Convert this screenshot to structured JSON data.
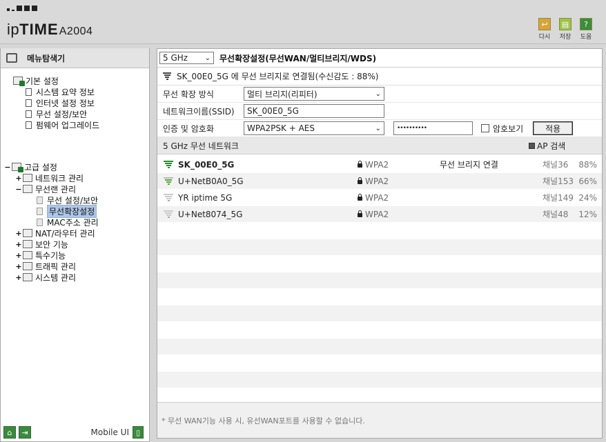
{
  "header": {
    "logo_text": "ipTIME",
    "model": "A2004",
    "actions": [
      {
        "label": "다시",
        "icon": "undo-icon",
        "color": "#d9a43a"
      },
      {
        "label": "저장",
        "icon": "save-icon",
        "color": "#9ec24a"
      },
      {
        "label": "도움",
        "icon": "help-icon",
        "color": "#3a8d3a"
      }
    ]
  },
  "sidebar": {
    "title": "메뉴탐색기",
    "basic": {
      "label": "기본 설정",
      "items": [
        "시스템 요약 정보",
        "인터넷 설정 정보",
        "무선 설정/보안",
        "펌웨어 업그레이드"
      ]
    },
    "advanced": {
      "toggle": "−",
      "label": "고급 설정",
      "items": [
        {
          "toggle": "+",
          "label": "네트워크 관리"
        },
        {
          "toggle": "−",
          "label": "무선랜 관리",
          "children": [
            "무선 설정/보안",
            "무선확장설정",
            "MAC주소 관리"
          ]
        },
        {
          "toggle": "+",
          "label": "NAT/라우터 관리"
        },
        {
          "toggle": "+",
          "label": "보안 기능"
        },
        {
          "toggle": "+",
          "label": "특수기능"
        },
        {
          "toggle": "+",
          "label": "트래픽 관리"
        },
        {
          "toggle": "+",
          "label": "시스템 관리"
        }
      ]
    },
    "footer": {
      "mobile_label": "Mobile UI"
    }
  },
  "main": {
    "band": "5 GHz",
    "title": "무선확장설정(무선WAN/멀티브리지/WDS)",
    "status": "SK_00E0_5G 에 무선 브리지로 연결됨(수신감도 : 88%)",
    "form": {
      "mode_label": "무선 확장 방식",
      "mode_value": "멀티 브리지(리피터)",
      "ssid_label": "네트워크이름(SSID)",
      "ssid_value": "SK_00E0_5G",
      "auth_label": "인증 및 암호화",
      "auth_value": "WPA2PSK + AES",
      "password_value": "••••••••••",
      "show_password_label": "암호보기",
      "apply_label": "적용"
    },
    "networks_header": "5 GHz 무선 네트워크",
    "ap_search_label": "AP 검색",
    "networks": [
      {
        "ssid": "SK_00E0_5G",
        "security": "WPA2",
        "status": "무선 브리지 연결",
        "channel": "채널36",
        "signal": "88%",
        "bold": true,
        "signal_color": "#2e8b2e"
      },
      {
        "ssid": "U+NetB0A0_5G",
        "security": "WPA2",
        "status": "",
        "channel": "채널153",
        "signal": "66%",
        "bold": false,
        "signal_color": "#5aa83a"
      },
      {
        "ssid": "YR iptime 5G",
        "security": "WPA2",
        "status": "",
        "channel": "채널149",
        "signal": "24%",
        "bold": false,
        "signal_color": "#aaaaaa"
      },
      {
        "ssid": "U+Net8074_5G",
        "security": "WPA2",
        "status": "",
        "channel": "채널48",
        "signal": "12%",
        "bold": false,
        "signal_color": "#aaaaaa"
      }
    ],
    "footnote": "* 무선 WAN기능 사용 시, 유선WAN포트를 사용할 수 없습니다."
  }
}
